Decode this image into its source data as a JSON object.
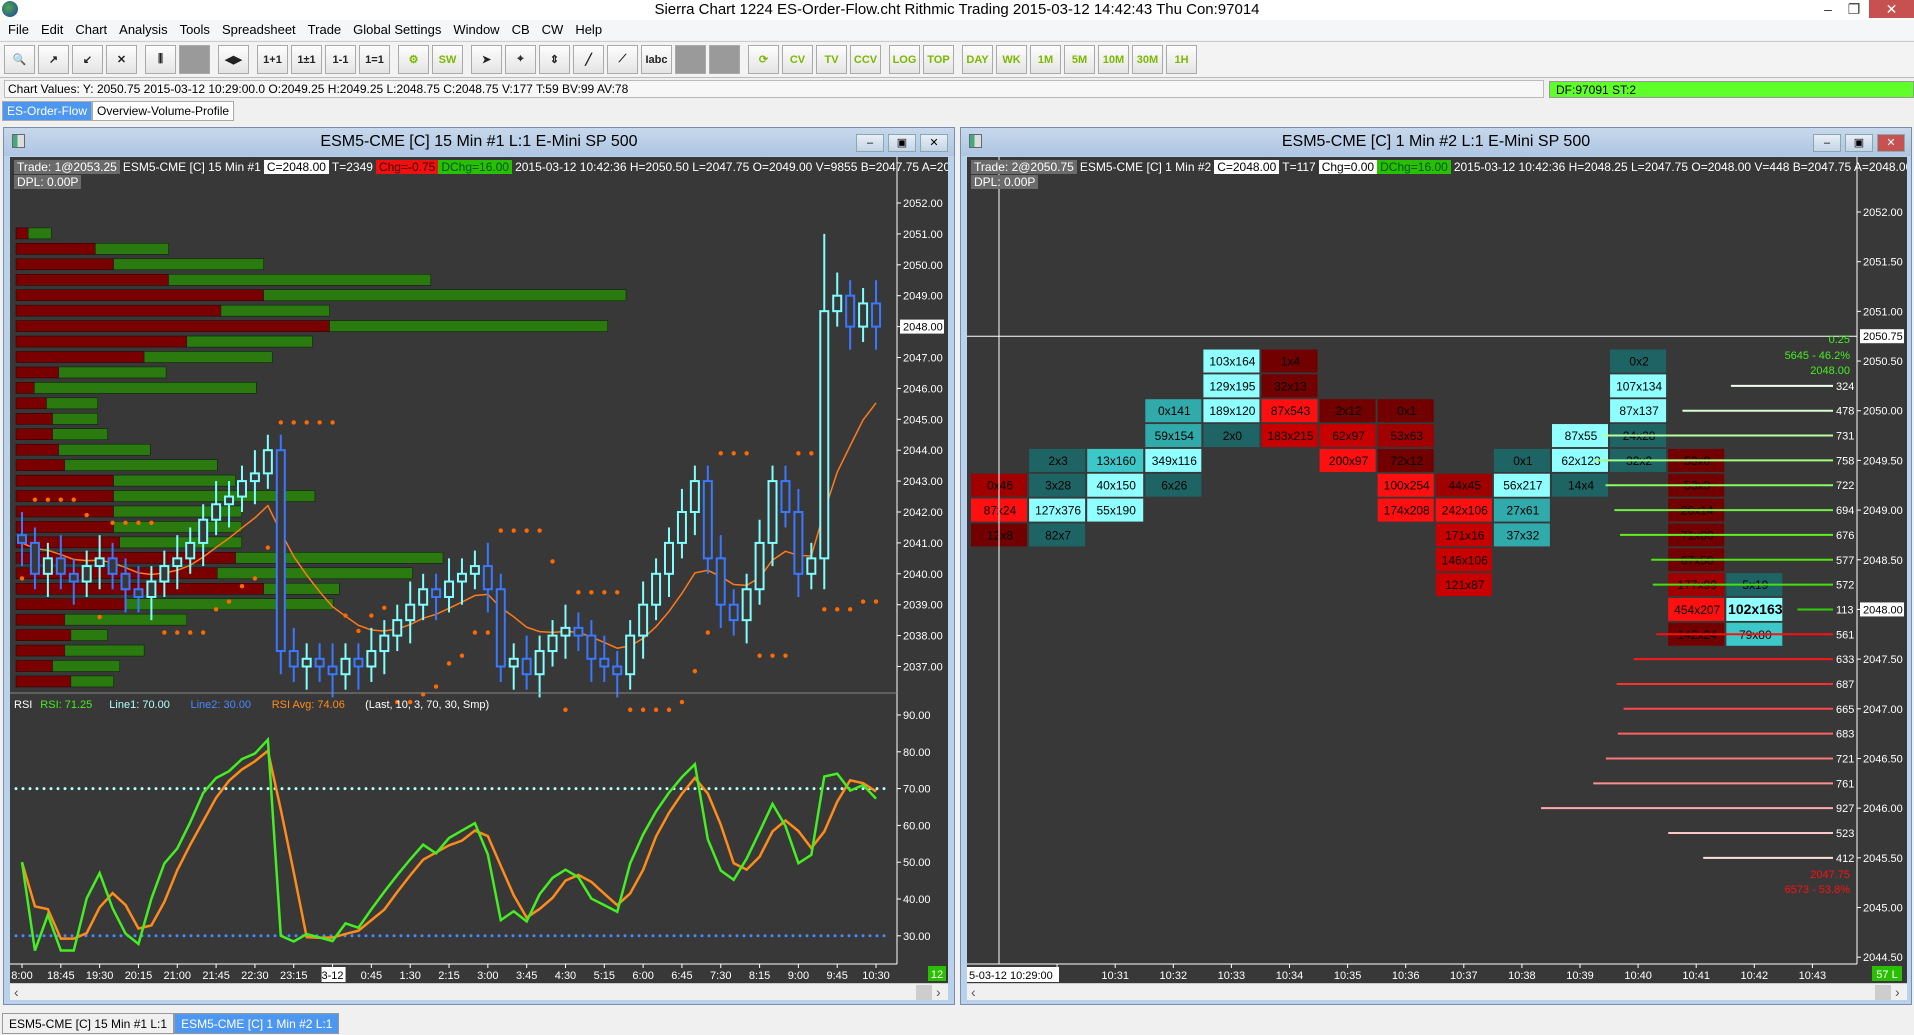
{
  "titlebar": {
    "title": "Sierra Chart 1224 ES-Order-Flow.cht  Rithmic Trading 2015-03-12  14:42:43 Thu  Con:97014",
    "minimize": "–",
    "restore": "❐",
    "close": "✕"
  },
  "menu": [
    "File",
    "Edit",
    "Chart",
    "Analysis",
    "Tools",
    "Spreadsheet",
    "Trade",
    "Global Settings",
    "Window",
    "CB",
    "CW",
    "Help"
  ],
  "toolbar": [
    {
      "name": "find-symbol",
      "glyph": "🔍"
    },
    {
      "name": "open-chart",
      "glyph": "↗"
    },
    {
      "name": "import",
      "glyph": "↙"
    },
    {
      "name": "close-chart",
      "glyph": "✕"
    },
    {
      "name": "studies",
      "glyph": "⫼"
    },
    {
      "name": "blank-1",
      "glyph": ""
    },
    {
      "name": "scroll-arrows",
      "glyph": "◀▶"
    },
    {
      "name": "increase-bar-spacing",
      "glyph": "1+1"
    },
    {
      "name": "bar-spacing-plusminus",
      "glyph": "1±1"
    },
    {
      "name": "decrease-bar-spacing",
      "glyph": "1-1"
    },
    {
      "name": "equal-spacing",
      "glyph": "1=1"
    },
    {
      "name": "chart-settings",
      "glyph": "⚙"
    },
    {
      "name": "sw",
      "glyph": "SW"
    },
    {
      "name": "pointer",
      "glyph": "➤"
    },
    {
      "name": "crosshair",
      "glyph": "⌖"
    },
    {
      "name": "measure",
      "glyph": "⇕"
    },
    {
      "name": "draw-line",
      "glyph": "╱"
    },
    {
      "name": "draw-ray",
      "glyph": "⟋"
    },
    {
      "name": "text-tool",
      "glyph": "Iabc"
    },
    {
      "name": "blank-2",
      "glyph": ""
    },
    {
      "name": "blank-3",
      "glyph": ""
    },
    {
      "name": "reload",
      "glyph": "⟳"
    },
    {
      "name": "cv",
      "glyph": "CV"
    },
    {
      "name": "tv",
      "glyph": "TV"
    },
    {
      "name": "ccv",
      "glyph": "CCV"
    },
    {
      "name": "log",
      "glyph": "LOG"
    },
    {
      "name": "top",
      "glyph": "TOP"
    },
    {
      "name": "day",
      "glyph": "DAY"
    },
    {
      "name": "wk",
      "glyph": "WK"
    },
    {
      "name": "1m",
      "glyph": "1M"
    },
    {
      "name": "5m",
      "glyph": "5M"
    },
    {
      "name": "10m",
      "glyph": "10M"
    },
    {
      "name": "30m",
      "glyph": "30M"
    },
    {
      "name": "1h",
      "glyph": "1H"
    }
  ],
  "chart_values": "Chart Values: Y: 2050.75  2015-03-12  10:29:00.0  O:2049.25  H:2049.25  L:2048.75  C:2048.75  V:177  T:59  BV:99  AV:78",
  "status": "DF:97091  ST:2",
  "tabs": [
    {
      "label": "ES-Order-Flow",
      "active": true
    },
    {
      "label": "Overview-Volume-Profile",
      "active": false
    }
  ],
  "left_chart": {
    "title": "ESM5-CME [C]  15 Min   #1  L:1  E-Mini SP 500",
    "info": {
      "trade": "Trade: 1@2053.25",
      "symbol": "ESM5-CME [C]  15 Min   #1",
      "close": "C=2048.00",
      "trades": "T=2349",
      "chg": "Chg=-0.75",
      "dchg": "DChg=16.00",
      "rest": "2015-03-12 10:42:36 H=2050.50 L=2047.75 O=2049.00 V=9855 B=2047.75 A=2048.00"
    },
    "dpl": "DPL: 0.00P",
    "price_labels": [
      "2052.00",
      "2051.00",
      "2050.00",
      "2049.00",
      "2048.00",
      "2047.00",
      "2046.00",
      "2045.00",
      "2044.00",
      "2043.00",
      "2042.00",
      "2041.00",
      "2040.00",
      "2039.00",
      "2038.00",
      "2037.00"
    ],
    "current_price": "2048.00",
    "rsi_legend": {
      "name": "RSI",
      "rsi": "RSI: 71.25",
      "line1": "Line1: 70.00",
      "line2": "Line2: 30.00",
      "avg": "RSI Avg: 74.06",
      "params": "(Last, 10, 3, 70, 30, Smp)"
    },
    "rsi_labels": [
      "90.00",
      "80.00",
      "70.00",
      "60.00",
      "50.00",
      "40.00",
      "30.00"
    ],
    "rsi_lines": {
      "line1": 70,
      "line2": 30
    },
    "time_labels": [
      "8:00",
      "18:45",
      "19:30",
      "20:15",
      "21:00",
      "21:45",
      "22:30",
      "23:15",
      "3-12",
      "0:45",
      "1:30",
      "2:15",
      "3:00",
      "3:45",
      "4:30",
      "5:15",
      "6:00",
      "6:45",
      "7:30",
      "8:15",
      "9:00",
      "9:45",
      "10:30"
    ],
    "date_marker": "3-12",
    "bar_count_badge": "12",
    "closes": [
      2041,
      2040,
      2040.5,
      2040,
      2039.75,
      2040.25,
      2040.5,
      2040,
      2039.5,
      2039.25,
      2039.75,
      2040.25,
      2040.5,
      2041,
      2041.75,
      2042.25,
      2042.5,
      2043,
      2043.25,
      2044,
      2037.5,
      2037,
      2037.25,
      2037,
      2036.75,
      2037.25,
      2037,
      2037.5,
      2038,
      2038.5,
      2039,
      2039.5,
      2039.25,
      2039.75,
      2040,
      2040.25,
      2039.5,
      2037,
      2037.25,
      2036.75,
      2037.5,
      2038,
      2038.25,
      2038,
      2037.25,
      2037,
      2036.75,
      2038,
      2039,
      2040,
      2041,
      2042,
      2043,
      2040.5,
      2039,
      2038.5,
      2039.5,
      2041,
      2043,
      2042,
      2040,
      2040.5,
      2048.5,
      2049,
      2048,
      2048.75,
      2048
    ],
    "volume_profile": [
      {
        "price": 2051.0,
        "sell": 10,
        "buy": 19
      },
      {
        "price": 2050.5,
        "sell": 65,
        "buy": 60
      },
      {
        "price": 2050.0,
        "sell": 80,
        "buy": 123
      },
      {
        "price": 2049.5,
        "sell": 125,
        "buy": 215
      },
      {
        "price": 2049.0,
        "sell": 203,
        "buy": 297
      },
      {
        "price": 2048.5,
        "sell": 168,
        "buy": 89
      },
      {
        "price": 2048.0,
        "sell": 257,
        "buy": 228
      },
      {
        "price": 2047.5,
        "sell": 140,
        "buy": 103
      },
      {
        "price": 2047.0,
        "sell": 105,
        "buy": 105
      },
      {
        "price": 2046.5,
        "sell": 35,
        "buy": 88
      },
      {
        "price": 2046.0,
        "sell": 15,
        "buy": 182
      },
      {
        "price": 2045.5,
        "sell": 25,
        "buy": 42
      },
      {
        "price": 2045.0,
        "sell": 30,
        "buy": 37
      },
      {
        "price": 2044.5,
        "sell": 30,
        "buy": 45
      },
      {
        "price": 2044.0,
        "sell": 35,
        "buy": 75
      },
      {
        "price": 2043.5,
        "sell": 40,
        "buy": 125
      },
      {
        "price": 2043.0,
        "sell": 80,
        "buy": 100
      },
      {
        "price": 2042.5,
        "sell": 80,
        "buy": 165
      },
      {
        "price": 2042.0,
        "sell": 80,
        "buy": 105
      },
      {
        "price": 2041.5,
        "sell": 80,
        "buy": 105
      },
      {
        "price": 2041.0,
        "sell": 85,
        "buy": 100
      },
      {
        "price": 2040.5,
        "sell": 180,
        "buy": 170
      },
      {
        "price": 2040.0,
        "sell": 165,
        "buy": 160
      },
      {
        "price": 2039.5,
        "sell": 203,
        "buy": 62
      },
      {
        "price": 2039.0,
        "sell": 90,
        "buy": 170
      },
      {
        "price": 2038.5,
        "sell": 40,
        "buy": 100
      },
      {
        "price": 2038.0,
        "sell": 45,
        "buy": 30
      },
      {
        "price": 2037.5,
        "sell": 40,
        "buy": 65
      },
      {
        "price": 2037.0,
        "sell": 30,
        "buy": 55
      },
      {
        "price": 2036.5,
        "sell": 45,
        "buy": 35
      }
    ],
    "colors": {
      "up": "#80ffff",
      "down": "#3a78ff",
      "ma": "#ff7a1a",
      "dots": "#ff6a00",
      "sell": "#7a0000",
      "buy": "#2a7a10",
      "rsi": "#44ee22",
      "rsi_avg": "#ff8c1a"
    }
  },
  "right_chart": {
    "title": "ESM5-CME [C]  1 Min   #2  L:1  E-Mini SP 500",
    "info": {
      "trade": "Trade: 2@2050.75",
      "symbol": "ESM5-CME [C]  1 Min   #2",
      "close": "C=2048.00",
      "trades": "T=117",
      "chg": "Chg=0.00",
      "dchg": "DChg=16.00",
      "rest": "2015-03-12 10:42:36 H=2048.25 L=2047.75 O=2048.00 V=448 B=2047.75 A=2048.00"
    },
    "dpl": "DPL: 0.00P",
    "price_labels": [
      "2052.00",
      "2051.50",
      "2051.00",
      "2050.50",
      "2050.00",
      "2049.50",
      "2049.00",
      "2048.50",
      "2048.00",
      "2047.50",
      "2047.00",
      "2046.50",
      "2046.00",
      "2045.50",
      "2045.00",
      "2044.50"
    ],
    "cursor_price": "2050.75",
    "current_price": "2048.00",
    "cursor_time": "5-03-12  10:29:00",
    "time_labels": [
      "30",
      "10:31",
      "10:32",
      "10:33",
      "10:34",
      "10:35",
      "10:36",
      "10:37",
      "10:38",
      "10:39",
      "10:40",
      "10:41",
      "10:42",
      "10:43"
    ],
    "bar_badge": "57 L",
    "cell_colors": {
      "dark_red": "#730000",
      "red": "#a00000",
      "mid_red": "#c80000",
      "bright_red": "#ff1010",
      "dark_teal": "#1e6464",
      "teal": "#30aaaa",
      "mid_teal": "#3cc8c8",
      "light_cyan": "#8fffff"
    },
    "columns": [
      {
        "time": "10:29",
        "cells": [
          {
            "p": 2049.25,
            "t": "0x46",
            "c": "red"
          },
          {
            "p": 2049.0,
            "t": "87x24",
            "c": "bright_red"
          },
          {
            "p": 2048.75,
            "t": "12x8",
            "c": "dark_red"
          }
        ]
      },
      {
        "time": "10:30",
        "cells": [
          {
            "p": 2049.5,
            "t": "2x3",
            "c": "dark_teal"
          },
          {
            "p": 2049.25,
            "t": "3x28",
            "c": "dark_teal"
          },
          {
            "p": 2049.0,
            "t": "127x376",
            "c": "light_cyan"
          },
          {
            "p": 2048.75,
            "t": "82x7",
            "c": "dark_teal"
          }
        ]
      },
      {
        "time": "10:31",
        "cells": [
          {
            "p": 2049.5,
            "t": "13x160",
            "c": "mid_teal"
          },
          {
            "p": 2049.25,
            "t": "40x150",
            "c": "light_cyan"
          },
          {
            "p": 2049.0,
            "t": "55x190",
            "c": "light_cyan"
          }
        ]
      },
      {
        "time": "10:32",
        "cells": [
          {
            "p": 2050.0,
            "t": "0x141",
            "c": "teal"
          },
          {
            "p": 2049.75,
            "t": "59x154",
            "c": "teal"
          },
          {
            "p": 2049.5,
            "t": "349x116",
            "c": "light_cyan"
          },
          {
            "p": 2049.25,
            "t": "6x26",
            "c": "dark_teal"
          }
        ]
      },
      {
        "time": "10:33",
        "cells": [
          {
            "p": 2050.5,
            "t": "103x164",
            "c": "light_cyan"
          },
          {
            "p": 2050.25,
            "t": "129x195",
            "c": "light_cyan"
          },
          {
            "p": 2050.0,
            "t": "189x120",
            "c": "light_cyan"
          },
          {
            "p": 2049.75,
            "t": "2x0",
            "c": "dark_teal"
          }
        ]
      },
      {
        "time": "10:34",
        "cells": [
          {
            "p": 2050.5,
            "t": "1x4",
            "c": "dark_red"
          },
          {
            "p": 2050.25,
            "t": "32x13",
            "c": "dark_red"
          },
          {
            "p": 2050.0,
            "t": "87x543",
            "c": "bright_red"
          },
          {
            "p": 2049.75,
            "t": "183x215",
            "c": "mid_red"
          }
        ]
      },
      {
        "time": "10:35",
        "cells": [
          {
            "p": 2050.0,
            "t": "2x12",
            "c": "dark_red"
          },
          {
            "p": 2049.75,
            "t": "62x97",
            "c": "mid_red"
          },
          {
            "p": 2049.5,
            "t": "200x97",
            "c": "bright_red"
          }
        ]
      },
      {
        "time": "10:36",
        "cells": [
          {
            "p": 2050.0,
            "t": "0x1",
            "c": "dark_red"
          },
          {
            "p": 2049.75,
            "t": "53x63",
            "c": "red"
          },
          {
            "p": 2049.5,
            "t": "72x12",
            "c": "dark_red"
          },
          {
            "p": 2049.25,
            "t": "100x254",
            "c": "bright_red"
          },
          {
            "p": 2049.0,
            "t": "174x208",
            "c": "bright_red"
          }
        ]
      },
      {
        "time": "10:37",
        "cells": [
          {
            "p": 2049.25,
            "t": "44x45",
            "c": "red"
          },
          {
            "p": 2049.0,
            "t": "242x106",
            "c": "bright_red"
          },
          {
            "p": 2048.75,
            "t": "171x16",
            "c": "mid_red"
          },
          {
            "p": 2048.5,
            "t": "146x106",
            "c": "mid_red"
          },
          {
            "p": 2048.25,
            "t": "121x87",
            "c": "mid_red"
          }
        ]
      },
      {
        "time": "10:38",
        "cells": [
          {
            "p": 2049.5,
            "t": "0x1",
            "c": "dark_teal"
          },
          {
            "p": 2049.25,
            "t": "56x217",
            "c": "light_cyan"
          },
          {
            "p": 2049.0,
            "t": "27x61",
            "c": "teal"
          },
          {
            "p": 2048.75,
            "t": "37x32",
            "c": "teal"
          }
        ]
      },
      {
        "time": "10:39",
        "cells": [
          {
            "p": 2049.75,
            "t": "87x55",
            "c": "light_cyan"
          },
          {
            "p": 2049.5,
            "t": "62x123",
            "c": "light_cyan"
          },
          {
            "p": 2049.25,
            "t": "14x4",
            "c": "dark_teal"
          }
        ]
      },
      {
        "time": "10:40",
        "cells": [
          {
            "p": 2050.5,
            "t": "0x2",
            "c": "dark_teal"
          },
          {
            "p": 2050.25,
            "t": "107x134",
            "c": "light_cyan"
          },
          {
            "p": 2050.0,
            "t": "87x137",
            "c": "light_cyan"
          },
          {
            "p": 2049.75,
            "t": "24x28",
            "c": "dark_teal"
          },
          {
            "p": 2049.5,
            "t": "32x2",
            "c": "dark_teal"
          }
        ]
      },
      {
        "time": "10:41",
        "cells": [
          {
            "p": 2049.5,
            "t": "53x0",
            "c": "dark_red"
          },
          {
            "p": 2049.25,
            "t": "53x3",
            "c": "dark_red"
          },
          {
            "p": 2049.0,
            "t": "26x14",
            "c": "dark_red"
          },
          {
            "p": 2048.75,
            "t": "71x80",
            "c": "dark_red"
          },
          {
            "p": 2048.5,
            "t": "67x50",
            "c": "dark_red"
          },
          {
            "p": 2048.25,
            "t": "177x99",
            "c": "red"
          },
          {
            "p": 2048.0,
            "t": "454x207",
            "c": "bright_red"
          },
          {
            "p": 2047.75,
            "t": "142x24",
            "c": "dark_red"
          }
        ]
      },
      {
        "time": "10:42",
        "cells": [
          {
            "p": 2048.25,
            "t": "5x19",
            "c": "dark_teal"
          },
          {
            "p": 2048.0,
            "t": "102x163",
            "c": "light_cyan",
            "bold": true
          },
          {
            "p": 2047.75,
            "t": "79x80",
            "c": "mid_teal"
          }
        ]
      }
    ],
    "profile": [
      {
        "p": 2050.25,
        "v": 324,
        "color": "#f0fff0"
      },
      {
        "p": 2050.0,
        "v": 478,
        "color": "#d8ffd0"
      },
      {
        "p": 2049.75,
        "v": 731,
        "color": "#b8ffa0"
      },
      {
        "p": 2049.5,
        "v": 758,
        "color": "#a0ff80"
      },
      {
        "p": 2049.25,
        "v": 722,
        "color": "#88ff60"
      },
      {
        "p": 2049.0,
        "v": 694,
        "color": "#70f040"
      },
      {
        "p": 2048.75,
        "v": 676,
        "color": "#60f020"
      },
      {
        "p": 2048.5,
        "v": 577,
        "color": "#50e810"
      },
      {
        "p": 2048.25,
        "v": 572,
        "color": "#44e010"
      },
      {
        "p": 2048.0,
        "v": 113,
        "color": "#30d000"
      },
      {
        "p": 2047.75,
        "v": 561,
        "color": "#ff1010"
      },
      {
        "p": 2047.5,
        "v": 633,
        "color": "#ff1818"
      },
      {
        "p": 2047.25,
        "v": 687,
        "color": "#ff3030"
      },
      {
        "p": 2047.0,
        "v": 665,
        "color": "#ff4848"
      },
      {
        "p": 2046.75,
        "v": 683,
        "color": "#ff6060"
      },
      {
        "p": 2046.5,
        "v": 721,
        "color": "#ff7878"
      },
      {
        "p": 2046.25,
        "v": 761,
        "color": "#ff9090"
      },
      {
        "p": 2046.0,
        "v": 927,
        "color": "#ffaaaa"
      },
      {
        "p": 2045.75,
        "v": 523,
        "color": "#ffc8c8"
      },
      {
        "p": 2045.5,
        "v": 412,
        "color": "#ffe0e0"
      }
    ],
    "buy_summary": {
      "tick": "0.25",
      "volume": "5645 - 46.2%",
      "price": "2048.00",
      "color": "#44ee22"
    },
    "sell_summary": {
      "price": "2047.75",
      "volume": "6573 - 53.8%",
      "color": "#ff1010"
    }
  },
  "bottom_tabs": [
    {
      "label": "ESM5-CME [C]  15 Min   #1  L:1",
      "active": false
    },
    {
      "label": "ESM5-CME [C]  1 Min   #2  L:1",
      "active": true
    }
  ],
  "scroll": {
    "left": "‹",
    "right": "›"
  }
}
